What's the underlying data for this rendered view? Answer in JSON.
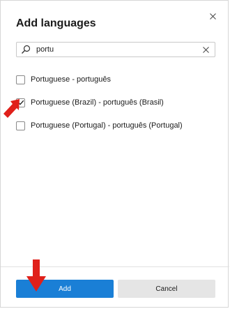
{
  "dialog": {
    "title": "Add languages",
    "close_icon": "close-icon"
  },
  "search": {
    "value": "portu",
    "placeholder": "",
    "search_icon": "search-icon",
    "clear_icon": "clear-icon"
  },
  "languages": [
    {
      "label": "Portuguese - português",
      "checked": false
    },
    {
      "label": "Portuguese (Brazil) - português (Brasil)",
      "checked": true
    },
    {
      "label": "Portuguese (Portugal) - português (Portugal)",
      "checked": false
    }
  ],
  "footer": {
    "add_label": "Add",
    "cancel_label": "Cancel"
  },
  "colors": {
    "accent": "#1a7fd6",
    "annotation_arrow": "#e0201a"
  }
}
